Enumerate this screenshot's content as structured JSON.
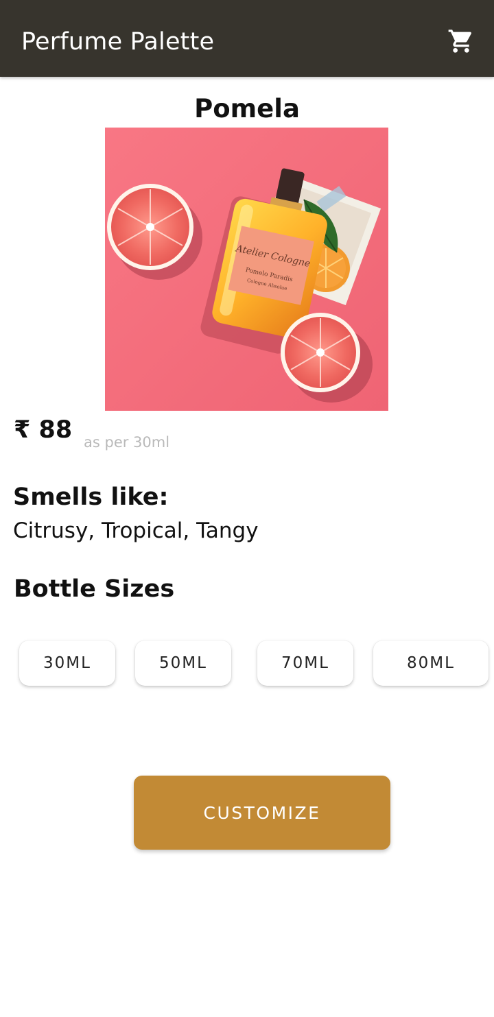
{
  "appbar": {
    "title": "Perfume Palette",
    "cart_icon": "shopping-cart-icon",
    "background": "#37342d"
  },
  "product": {
    "name": "Pomela",
    "image_label": "Atelier Cologne",
    "image_sublabel": "Pomelo Paradis",
    "image_subsublabel": "Cologne Absolue",
    "price": "₹ 88",
    "price_note": "as per 30ml",
    "smells_heading": "Smells like:",
    "smells_text": "Citrusy, Tropical, Tangy"
  },
  "sizes": {
    "heading": "Bottle Sizes",
    "options": [
      "30ML",
      "50ML",
      "70ML",
      "80ML"
    ]
  },
  "customize": {
    "label": "CUSTOMIZE",
    "color": "#c28a35"
  },
  "colors": {
    "image_background": "#f46e7b",
    "accent": "#c28a35"
  }
}
